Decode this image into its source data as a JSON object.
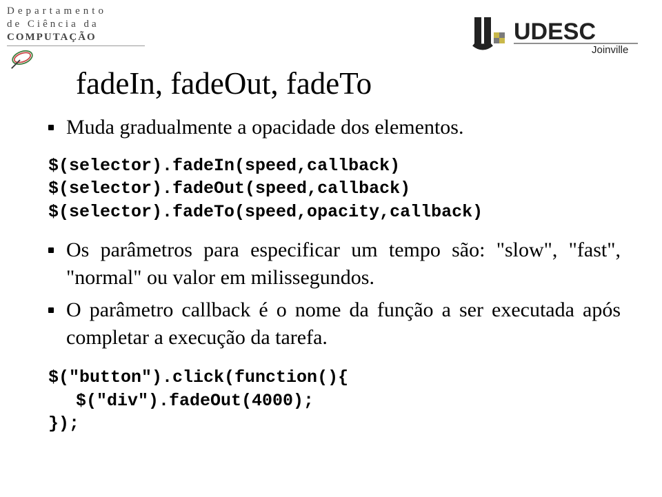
{
  "header": {
    "dept_line1": "Departamento",
    "dept_line2": "de Ciência da",
    "dept_line3": "COMPUTAÇÃO",
    "university": "UDESC",
    "campus": "Joinville"
  },
  "slide": {
    "title": "fadeIn, fadeOut, fadeTo",
    "bullet1": "Muda gradualmente a opacidade dos elementos.",
    "code1_line1": "$(selector).fadeIn(speed,callback)",
    "code1_line2": "$(selector).fadeOut(speed,callback)",
    "code1_line3": "$(selector).fadeTo(speed,opacity,callback)",
    "bullet2": "Os parâmetros para especificar um tempo são: \"slow\", \"fast\", \"normal\" ou valor em milissegundos.",
    "bullet3": "O parâmetro callback é o nome da função a ser executada após completar a execução da tarefa.",
    "code2_line1": "$(\"button\").click(function(){",
    "code2_line2": "$(\"div\").fadeOut(4000);",
    "code2_line3": "});"
  }
}
